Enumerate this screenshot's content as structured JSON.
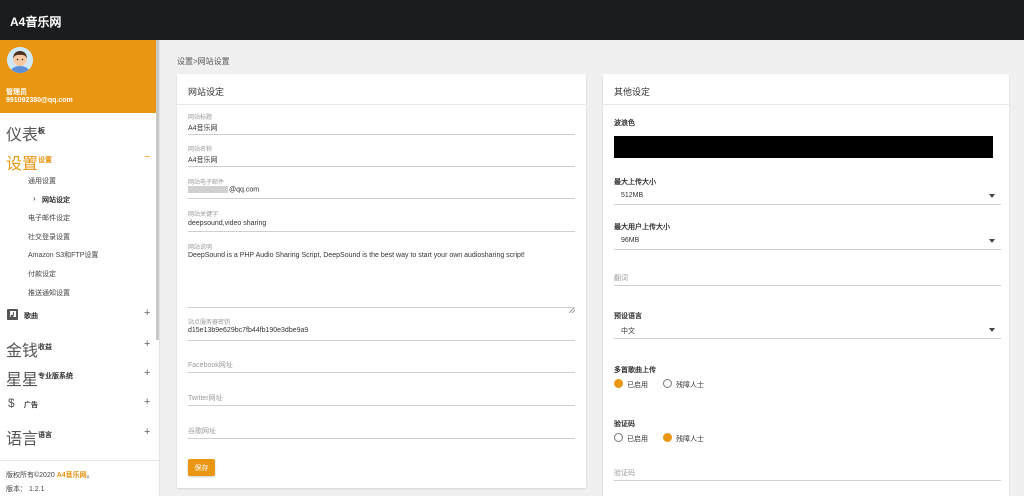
{
  "app": {
    "brand": "A4音乐网"
  },
  "user": {
    "name": "管理员",
    "email": "991092380@qq.com"
  },
  "nav": {
    "dashboard": {
      "big": "仪表",
      "label": "板"
    },
    "settings": {
      "big": "设置",
      "label": "设置",
      "sign": "−"
    },
    "songs": {
      "label": "歌曲",
      "sign": "+",
      "icon": "music-library-icon"
    },
    "earnings": {
      "big": "金钱",
      "label": "收益",
      "sign": "+"
    },
    "pro": {
      "big": "星星",
      "label": "专业版系统",
      "sign": "+"
    },
    "ads": {
      "label": "广告",
      "sign": "+",
      "icon": "dollar-icon"
    },
    "languages": {
      "big": "语言",
      "label": "语言",
      "sign": "+"
    }
  },
  "subnav": {
    "general": "通用设置",
    "website": "网站设定",
    "email": "电子邮件设定",
    "social": "社交登录设置",
    "s3": "Amazon S3和FTP设置",
    "payment": "付款设定",
    "push": "推送通知设置"
  },
  "footer": {
    "copyright_prefix": "版权所有©2020 ",
    "copyright_brand": "A4音乐网",
    "copyright_suffix": "。",
    "version": "版本： 1.2.1"
  },
  "breadcrumb": "设置>网站设置",
  "left_card": {
    "title": "网站设定",
    "site_title_label": "网站标题",
    "site_title_value": "A4音乐网",
    "site_name_label": "网站名称",
    "site_name_value": "A4音乐网",
    "site_email_label": "网站电子邮件",
    "site_email_value": "@qq.com",
    "keywords_label": "网站关键字",
    "keywords_value": "deepsound,video sharing",
    "description_label": "网站说明",
    "description_value": "DeepSound is a PHP Audio Sharing Script, DeepSound is the best way to start your own audiosharing script!",
    "server_key_label": "站点服务器密钥",
    "server_key_value": "d15e13b9e629bc7fb44fb190e3dbe9a9",
    "facebook_placeholder": "Facebook网址",
    "twitter_placeholder": "Twitter网址",
    "youtube_placeholder": "谷歌网址",
    "save_label": "保存"
  },
  "right_card": {
    "title": "其他设定",
    "wave_color_label": "波浪色",
    "wave_color_value": "#000000",
    "max_upload_label": "最大上传大小",
    "max_upload_value": "512MB",
    "max_user_upload_label": "最大用户上传大小",
    "max_user_upload_value": "96MB",
    "lyrics_placeholder": "翻词",
    "default_lang_label": "预设语言",
    "default_lang_value": "中文",
    "multi_upload_label": "多首歌曲上传",
    "multi_upload_options": [
      "已启用",
      "残障人士"
    ],
    "multi_upload_selected": 0,
    "captcha_label": "验证码",
    "captcha_options": [
      "已启用",
      "残障人士"
    ],
    "captcha_selected": 1,
    "captcha_placeholder": "验证码"
  },
  "colors": {
    "accent": "#e99613",
    "topbar": "#1b1c1e"
  }
}
